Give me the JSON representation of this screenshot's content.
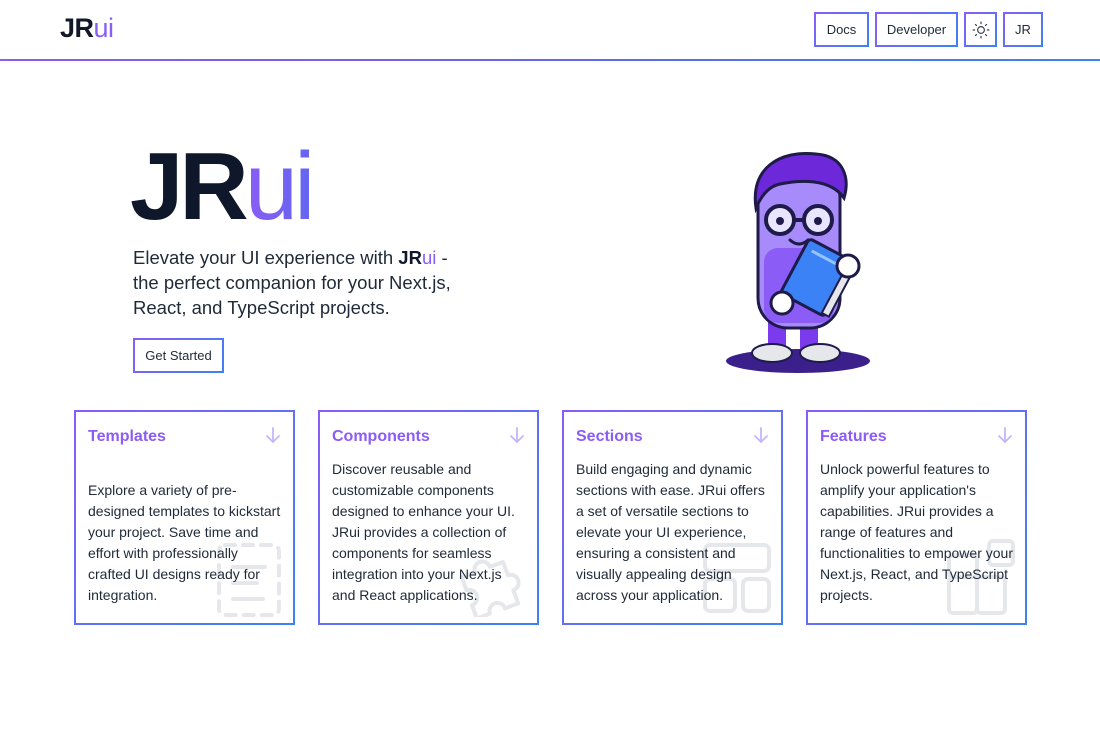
{
  "header": {
    "logo_jr": "JR",
    "logo_ui": "ui",
    "nav": {
      "docs": "Docs",
      "developer": "Developer",
      "profile": "JR"
    },
    "theme_icon": "sun-icon"
  },
  "hero": {
    "title_jr": "JR",
    "title_ui": "ui",
    "text_pre": "Elevate your UI experience with ",
    "text_brand_jr": "JR",
    "text_brand_ui": "ui",
    "text_post": " - the perfect companion for your Next.js, React, and TypeScript projects.",
    "cta": "Get Started",
    "illustration": "mascot-illustration"
  },
  "cards": [
    {
      "title": "Templates",
      "body": "Explore a variety of pre-designed templates to kickstart your project. Save time and effort with professionally crafted UI designs ready for integration.",
      "icon": "template-icon"
    },
    {
      "title": "Components",
      "body": "Discover reusable and customizable components designed to enhance your UI. JRui provides a collection of components for seamless integration into your Next.js and React applications.",
      "icon": "puzzle-icon"
    },
    {
      "title": "Sections",
      "body": "Build engaging and dynamic sections with ease. JRui offers a set of versatile sections to elevate your UI experience, ensuring a consistent and visually appealing design across your application.",
      "icon": "layout-icon"
    },
    {
      "title": "Features",
      "body": "Unlock powerful features to amplify your application's capabilities. JRui provides a range of features and functionalities to empower your Next.js, React, and TypeScript projects.",
      "icon": "blocks-icon"
    }
  ],
  "colors": {
    "accent": "#8b5cf6",
    "accent_blue": "#3b82f6",
    "text": "#111827"
  }
}
